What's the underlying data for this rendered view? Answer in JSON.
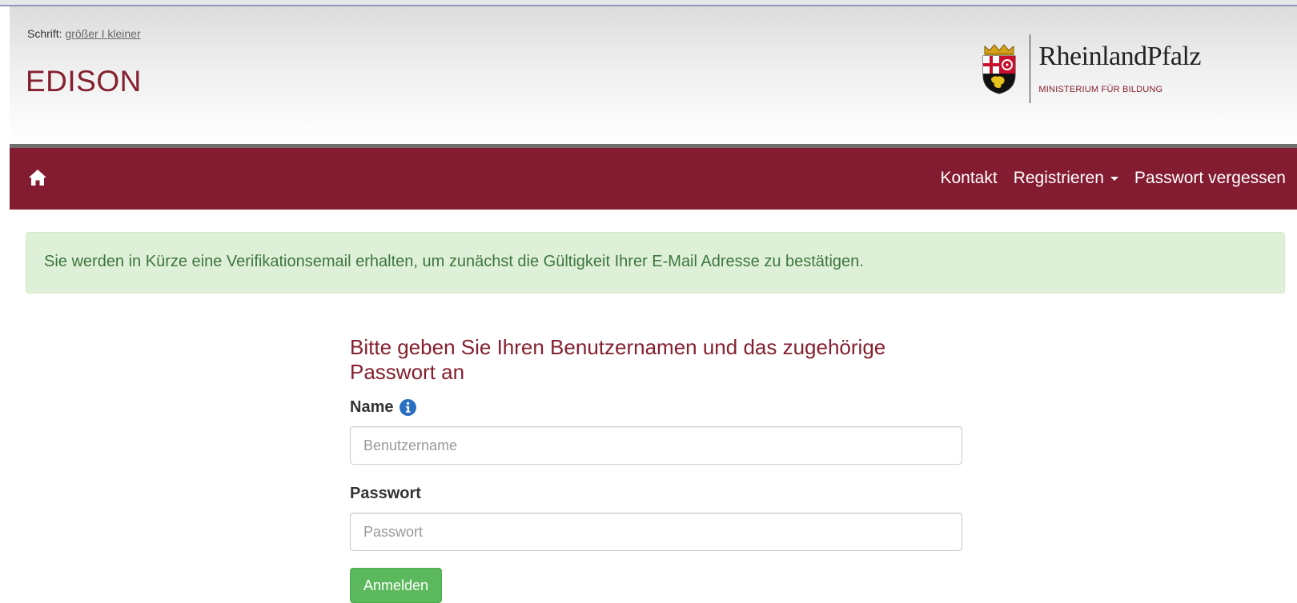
{
  "header": {
    "font_label": "Schrift:",
    "font_larger": "größer",
    "font_separator": "I",
    "font_smaller": "kleiner",
    "app_title": "EDISON",
    "logo_name": "RheinlandPfalz",
    "logo_subtitle": "MINISTERIUM FÜR BILDUNG"
  },
  "nav": {
    "home_icon": "home-icon",
    "items": [
      {
        "label": "Kontakt"
      },
      {
        "label": "Registrieren",
        "has_dropdown": true
      },
      {
        "label": "Passwort vergessen"
      }
    ]
  },
  "alert": {
    "message": "Sie werden in Kürze eine Verifikationsemail erhalten, um zunächst die Gültigkeit Ihrer E-Mail Adresse zu bestätigen."
  },
  "login": {
    "heading": "Bitte geben Sie Ihren Benutzernamen und das zugehörige Passwort an",
    "name_label": "Name",
    "name_info_icon": "info-circle-icon",
    "name_placeholder": "Benutzername",
    "name_value": "",
    "password_label": "Passwort",
    "password_placeholder": "Passwort",
    "password_value": "",
    "submit_label": "Anmelden"
  },
  "colors": {
    "brand": "#841c31",
    "title": "#84202f",
    "alert_bg": "#dff0d8",
    "alert_text": "#3c763d",
    "button": "#5cb85c",
    "info_icon": "#2a6fc0"
  }
}
